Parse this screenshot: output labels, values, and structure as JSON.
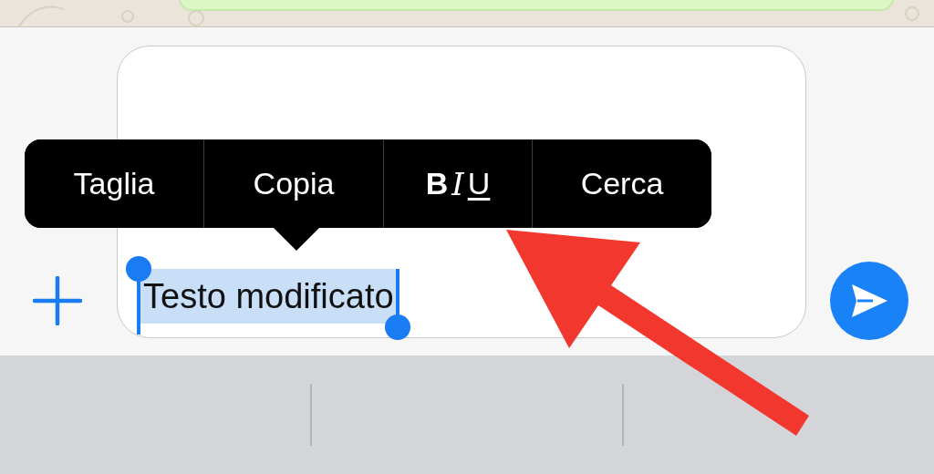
{
  "menu": [
    {
      "kind": "text",
      "label": "Taglia"
    },
    {
      "kind": "text",
      "label": "Copia"
    },
    {
      "kind": "format",
      "parts": [
        {
          "label": "B",
          "kind": "bold"
        },
        {
          "label": "I",
          "kind": "italic"
        },
        {
          "label": "U",
          "kind": "underline"
        }
      ]
    },
    {
      "kind": "text",
      "label": "Cerca"
    }
  ],
  "composer": {
    "value": "Testo modificato",
    "selected": true
  }
}
